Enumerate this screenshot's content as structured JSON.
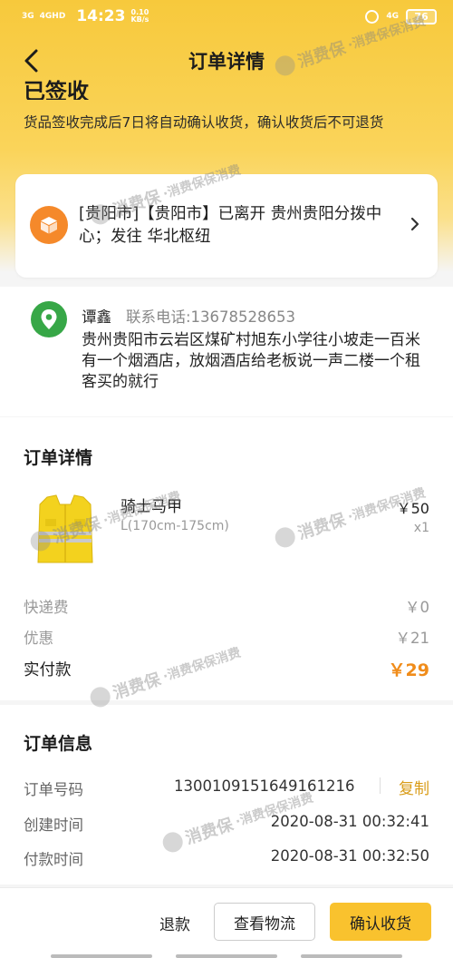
{
  "status_bar": {
    "network_left": "3G",
    "network_left2": "4GHD",
    "time": "14:23",
    "speed_value": "0.10",
    "speed_unit": "KB/s",
    "network_right": "4G",
    "battery": "76"
  },
  "nav": {
    "title": "订单详情"
  },
  "order_status": {
    "title": "已签收",
    "description": "货品签收完成后7日将自动确认收货，确认收货后不可退货"
  },
  "logistics": {
    "latest_update": "[贵阳市]【贵阳市】已离开 贵州贵阳分拨中心；发往 华北枢纽"
  },
  "address": {
    "name": "谭鑫",
    "phone": "联系电话:13678528653",
    "detail": "贵州贵阳市云岩区煤矿村旭东小学往小坡走一百米有一个烟酒店，放烟酒店给老板说一声二楼一个租客买的就行"
  },
  "order_details": {
    "title": "订单详情",
    "product": {
      "name": "骑士马甲",
      "spec": "L(170cm-175cm)",
      "price": "￥50",
      "quantity": "x1"
    },
    "shipping_label": "快递费",
    "shipping_value": "￥0",
    "discount_label": "优惠",
    "discount_value": "￥21",
    "paid_label": "实付款",
    "paid_value": "￥29"
  },
  "order_info": {
    "title": "订单信息",
    "order_no_label": "订单号码",
    "order_no": "1300109151649161216",
    "copy_label": "复制",
    "created_label": "创建时间",
    "created_value": "2020-08-31 00:32:41",
    "paid_label": "付款时间",
    "paid_value": "2020-08-31 00:32:50"
  },
  "actions": {
    "refund": "退款",
    "view_logistics": "查看物流",
    "confirm_receipt": "确认收货"
  },
  "watermark": {
    "main": "消费保",
    "sub": "·消费保保消费"
  },
  "colors": {
    "header_yellow": "#f7c93c",
    "accent_orange": "#f08c1a",
    "copy_gold": "#d99c18",
    "confirm_button": "#f9c22e",
    "logistics_icon": "#f5892a",
    "location_icon": "#37a747"
  },
  "icons": [
    "back-arrow-icon",
    "alarm-icon",
    "battery-icon",
    "package-box-icon",
    "chevron-right-icon",
    "location-pin-icon"
  ]
}
